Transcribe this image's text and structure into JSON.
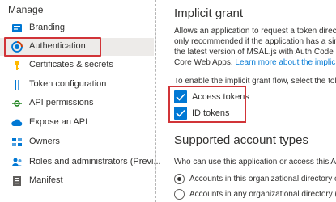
{
  "sidebar": {
    "section_title": "Manage",
    "items": [
      {
        "label": "Branding",
        "icon": "branding-icon"
      },
      {
        "label": "Authentication",
        "icon": "authentication-icon",
        "active": true
      },
      {
        "label": "Certificates & secrets",
        "icon": "key-icon"
      },
      {
        "label": "Token configuration",
        "icon": "token-icon"
      },
      {
        "label": "API permissions",
        "icon": "api-permissions-icon"
      },
      {
        "label": "Expose an API",
        "icon": "cloud-icon"
      },
      {
        "label": "Owners",
        "icon": "owners-icon"
      },
      {
        "label": "Roles and administrators (Previ...",
        "icon": "roles-icon"
      },
      {
        "label": "Manifest",
        "icon": "manifest-icon"
      }
    ]
  },
  "main": {
    "implicit_title": "Implicit grant",
    "paragraph_lines": [
      "Allows an application to request a token direc",
      "only recommended if the application has a sing",
      "the latest version of MSAL.js with Auth Code F"
    ],
    "paragraph_last_prefix": "Core Web Apps. ",
    "paragraph_link": "Learn more about the implicit",
    "enable_text": "To enable the implicit grant flow, select the toke",
    "checkboxes": [
      {
        "label": "Access tokens",
        "checked": true
      },
      {
        "label": "ID tokens",
        "checked": true
      }
    ],
    "supported_title": "Supported account types",
    "supported_question": "Who can use this application or access this API?",
    "radios": [
      {
        "label": "Accounts in this organizational directory on",
        "selected": true
      },
      {
        "label": "Accounts in any organizational directory (A",
        "selected": false
      }
    ]
  },
  "colors": {
    "accent": "#0078d4",
    "highlight_border": "#d13438",
    "active_bg": "#edebe9"
  }
}
